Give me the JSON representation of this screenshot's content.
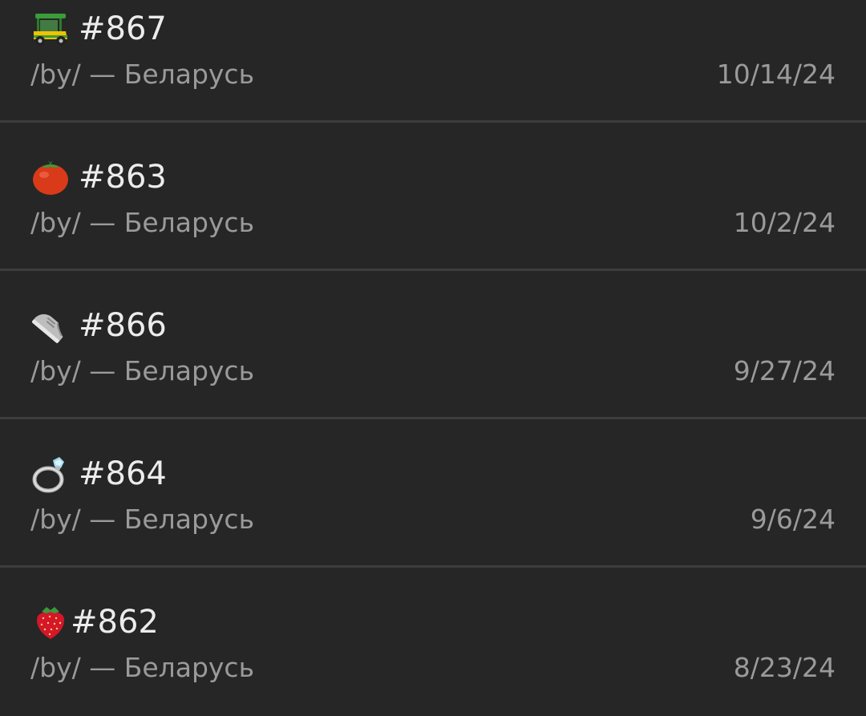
{
  "items": [
    {
      "emoji_icon": "auto-rickshaw-icon",
      "title": "#867",
      "subtitle": "/by/ — Беларусь",
      "date": "10/14/24"
    },
    {
      "emoji_icon": "tomato-icon",
      "title": "#863",
      "subtitle": "/by/ — Беларусь",
      "date": "10/2/24"
    },
    {
      "emoji_icon": "sneaker-icon",
      "title": "#866",
      "subtitle": "/by/ — Беларусь",
      "date": "9/27/24"
    },
    {
      "emoji_icon": "ring-icon",
      "title": "#864",
      "subtitle": "/by/ — Беларусь",
      "date": "9/6/24"
    },
    {
      "emoji_icon": "strawberry-icon",
      "title": "#862",
      "subtitle": "/by/ — Беларусь",
      "date": "8/23/24"
    }
  ],
  "colors": {
    "background": "#262626",
    "divider": "#3d3d3d",
    "title_text": "#ececec",
    "secondary_text": "#9a9a9a"
  }
}
